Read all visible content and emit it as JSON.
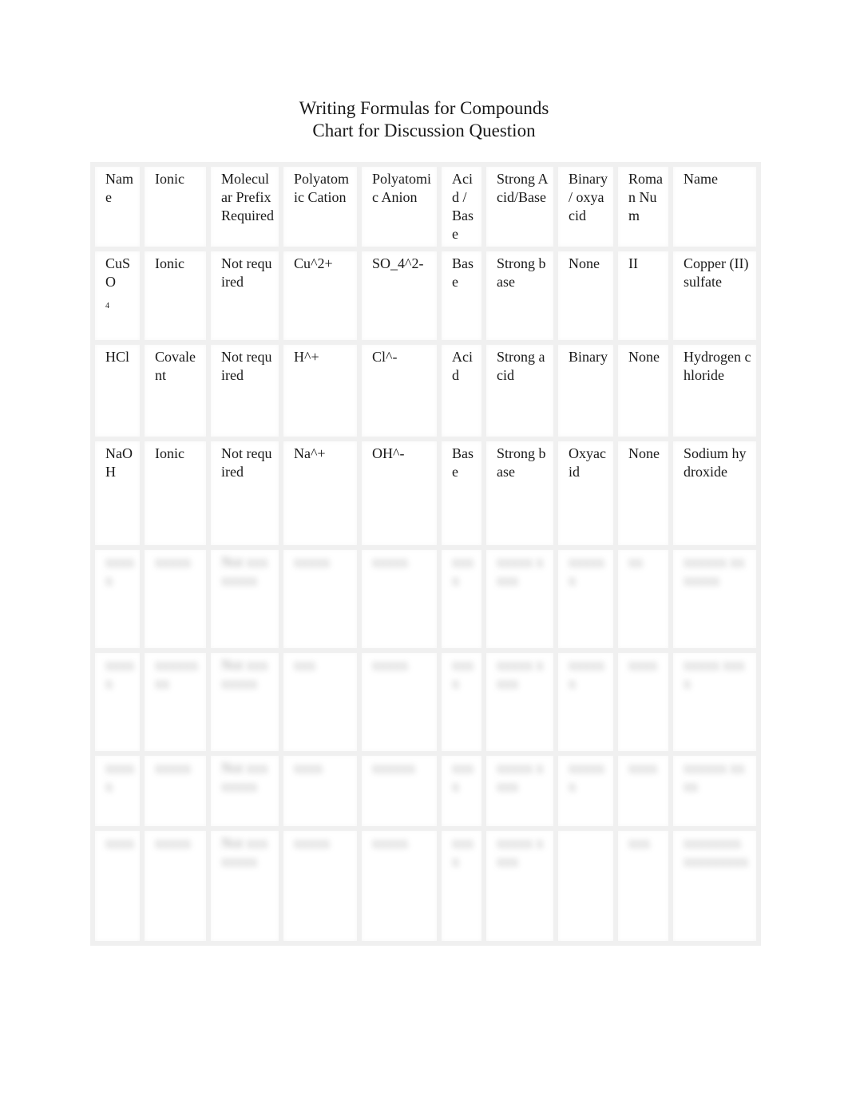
{
  "document": {
    "title_line1": "Writing Formulas for Compounds",
    "title_line2": "Chart for Discussion Question"
  },
  "table": {
    "headers": [
      "Name",
      "Ionic",
      "Molecular Prefix Required",
      "Polyatomic Cation",
      "Polyatomic Anion",
      "Acid / Base",
      "Strong Acid/Base",
      "Binary / oxyacid",
      "Roman Num",
      "Name"
    ],
    "rows": [
      {
        "formula_main": "CuSO",
        "formula_sub": "4",
        "bond": "Ionic",
        "prefix": "Not required",
        "cation": "Cu^2+",
        "anion": "SO_4^2-",
        "acid_base": "Base",
        "strength": "Strong base",
        "binary_oxy": "None",
        "roman": "II",
        "name": "Copper (II) sulfate"
      },
      {
        "formula_main": "HCl",
        "formula_sub": "",
        "bond": "Covalent",
        "prefix": "Not required",
        "cation": "H^+",
        "anion": "Cl^-",
        "acid_base": "Acid",
        "strength": "Strong acid",
        "binary_oxy": "Binary",
        "roman": "None",
        "name": "Hydrogen chloride"
      },
      {
        "formula_main": "NaOH",
        "formula_sub": "",
        "bond": "Ionic",
        "prefix": "Not required",
        "cation": "Na^+",
        "anion": "OH^-",
        "acid_base": "Base",
        "strength": "Strong base",
        "binary_oxy": "Oxyacid",
        "roman": "None",
        "name": "Sodium hydroxide"
      }
    ],
    "blurred_rows": [
      [
        "xxxxx",
        "xxxxx",
        "Not xxxxxxxx",
        "xxxxx",
        "xxxxx",
        "xxxx",
        "xxxxx xxxx",
        "xxxxxx",
        "xx",
        "xxxxxx xxxxxxx"
      ],
      [
        "xxxxx",
        "xxxxxxxx",
        "Not xxxxxxxx",
        "xxx",
        "xxxxx",
        "xxxx",
        "xxxxx xxxx",
        "xxxxxx",
        "xxxx",
        "xxxxx xxxx"
      ],
      [
        "xxxxx",
        "xxxxx",
        "Not xxxxxxxx",
        "xxxx",
        "xxxxxx",
        "xxxx",
        "xxxxx xxxx",
        "xxxxxx",
        "xxxx",
        "xxxxxx xxxx"
      ],
      [
        "xxxx",
        "xxxxx",
        "Not xxxxxxxx",
        "xxxxx",
        "xxxxx",
        "xxxx",
        "xxxxx xxxx",
        "",
        "xxx",
        "xxxxxxxx xxxxxxxxx"
      ]
    ]
  }
}
